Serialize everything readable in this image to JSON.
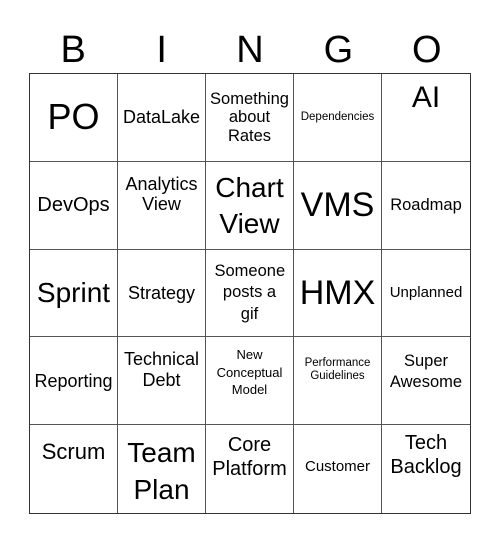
{
  "header": [
    "B",
    "I",
    "N",
    "G",
    "O"
  ],
  "cells": [
    {
      "text": "PO"
    },
    {
      "text": "DataLake"
    },
    {
      "text": "Something about Rates"
    },
    {
      "text": "Dependencies"
    },
    {
      "text": "AI"
    },
    {
      "text": "DevOps"
    },
    {
      "text": "Analytics View"
    },
    {
      "text": "Chart View"
    },
    {
      "text": "VMS"
    },
    {
      "text": "Roadmap"
    },
    {
      "text": "Sprint"
    },
    {
      "text": "Strategy"
    },
    {
      "text": "Someone posts a gif"
    },
    {
      "text": "HMX"
    },
    {
      "text": "Unplanned"
    },
    {
      "text": "Reporting"
    },
    {
      "text": "Technical Debt"
    },
    {
      "text": "New Conceptual Model"
    },
    {
      "text": "Performance Guidelines"
    },
    {
      "text": "Super Awesome"
    },
    {
      "text": "Scrum"
    },
    {
      "text": "Team Plan"
    },
    {
      "text": "Core Platform"
    },
    {
      "text": "Customer"
    },
    {
      "text": "Tech Backlog"
    }
  ]
}
